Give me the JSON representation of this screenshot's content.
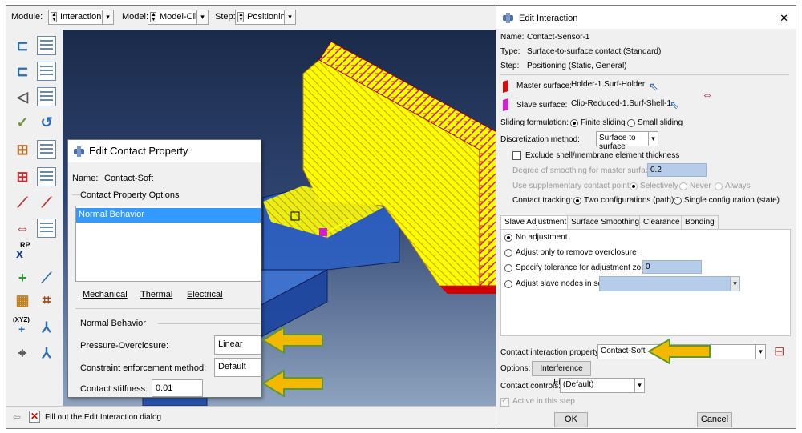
{
  "context_bar": {
    "module_label": "Module:",
    "module_value": "Interaction",
    "model_label": "Model:",
    "model_value": "Model-Clip",
    "step_label": "Step:",
    "step_value": "Positioning"
  },
  "toolbox": {
    "rp_label": "RP",
    "xyz_label": "(XYZ)"
  },
  "prompt": {
    "text": "Fill out the Edit Interaction dialog"
  },
  "contact_property_dialog": {
    "title": "Edit Contact Property",
    "name_label": "Name:",
    "name_value": "Contact-Soft",
    "options_group": "Contact Property Options",
    "options": [
      "Normal Behavior"
    ],
    "menus": [
      "Mechanical",
      "Thermal",
      "Electrical"
    ],
    "section_title": "Normal Behavior",
    "pressure_label": "Pressure-Overclosure:",
    "pressure_value": "Linear",
    "constraint_label": "Constraint enforcement method:",
    "constraint_value": "Default",
    "stiffness_label": "Contact stiffness:",
    "stiffness_value": "0.01"
  },
  "interaction_dialog": {
    "title": "Edit Interaction",
    "name_label": "Name:",
    "name_value": "Contact-Sensor-1",
    "type_label": "Type:",
    "type_value": "Surface-to-surface contact (Standard)",
    "step_label": "Step:",
    "step_value": "Positioning (Static, General)",
    "master_label": "Master surface:",
    "master_value": "Holder-1.Surf-Holder",
    "slave_label": "Slave surface:",
    "slave_value": "Clip-Reduced-1.Surf-Shell-1",
    "sliding_label": "Sliding formulation:",
    "sliding_finite": "Finite sliding",
    "sliding_small": "Small sliding",
    "discretization_label": "Discretization method:",
    "discretization_value": "Surface to surface",
    "exclude_label": "Exclude shell/membrane element thickness",
    "smoothing_label": "Degree of smoothing for master surface:",
    "smoothing_value": "0.2",
    "supp_label": "Use supplementary contact points:",
    "supp_selectively": "Selectively",
    "supp_never": "Never",
    "supp_always": "Always",
    "tracking_label": "Contact tracking:",
    "tracking_two": "Two configurations (path)",
    "tracking_single": "Single configuration (state)",
    "tabs": [
      "Slave Adjustment",
      "Surface Smoothing",
      "Clearance",
      "Bonding"
    ],
    "adj_none": "No adjustment",
    "adj_overclosure": "Adjust only to remove overclosure",
    "adj_tolerance": "Specify tolerance for adjustment zone:",
    "adj_tolerance_value": "0",
    "adj_nodes": "Adjust slave nodes in set:",
    "property_label": "Contact interaction property:",
    "property_value": "Contact-Soft",
    "options_label": "Options:",
    "interference_button": "Interference Fit...",
    "controls_label": "Contact controls:",
    "controls_value": "(Default)",
    "active_label": "Active in this step",
    "ok_button": "OK",
    "cancel_button": "Cancel"
  },
  "colors": {
    "highlight": "#3399ff",
    "arrow_fill": "#f5b800",
    "arrow_outline": "#5a9a30",
    "mesh_yellow": "#ffff00",
    "mesh_red": "#e00000",
    "part_blue": "#2a60c8"
  }
}
